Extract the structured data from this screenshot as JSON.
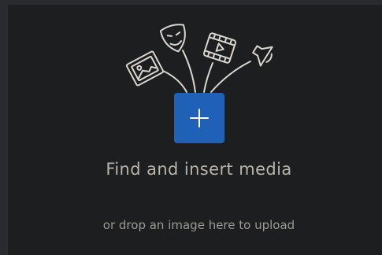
{
  "media_placeholder": {
    "title": "Find and insert media",
    "subtitle": "or drop an image here to upload",
    "insert_button_icon": "plus-icon",
    "icons": [
      "image-icon",
      "theater-masks-icon",
      "video-icon",
      "audio-speaker-icon"
    ]
  },
  "colors": {
    "background": "#1d1e20",
    "accent": "#1e61b7",
    "illustration_stroke": "#d9d5cf",
    "title_text": "#b9b4ad",
    "subtitle_text": "#9d9892"
  }
}
